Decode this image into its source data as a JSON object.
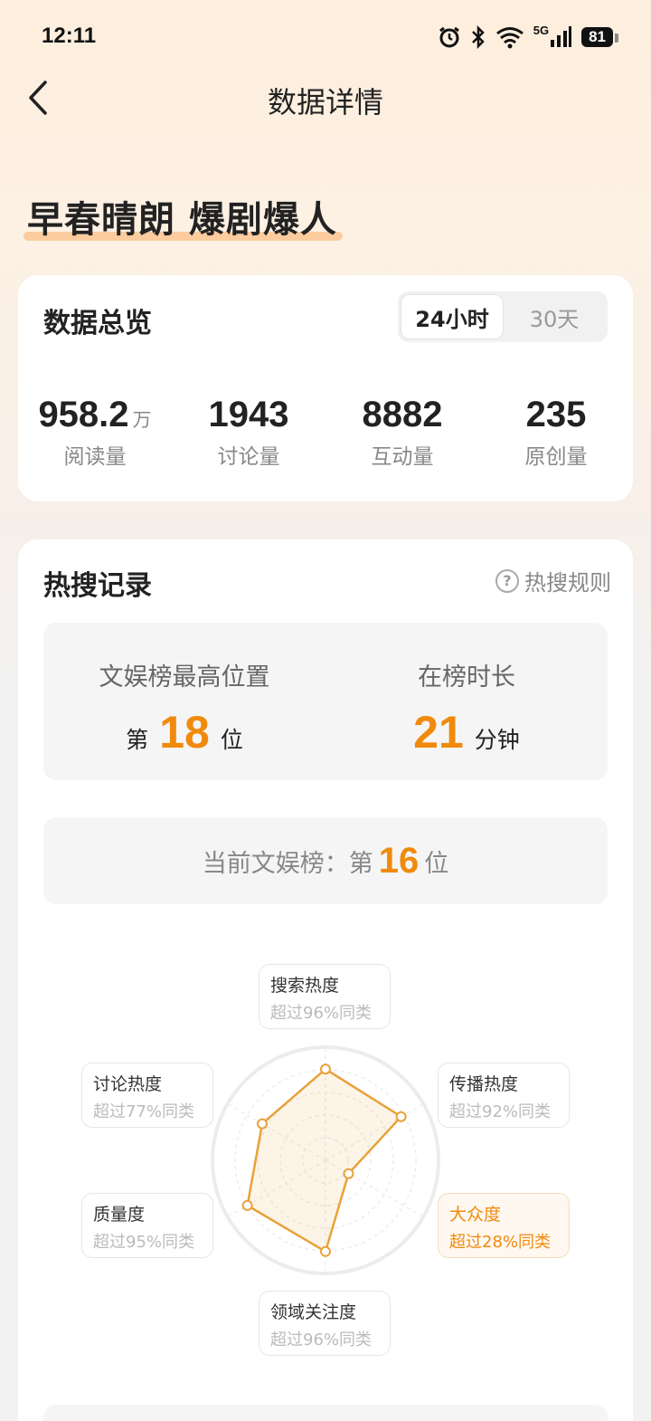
{
  "status": {
    "time": "12:11",
    "battery": "81",
    "network": "5G"
  },
  "nav": {
    "title": "数据详情"
  },
  "topic": {
    "title": "早春晴朗 爆剧爆人"
  },
  "overview": {
    "title": "数据总览",
    "tabs": [
      {
        "label": "24小时",
        "active": true
      },
      {
        "label": "30天",
        "active": false
      }
    ],
    "stats": [
      {
        "value": "958.2",
        "unit": "万",
        "label": "阅读量"
      },
      {
        "value": "1943",
        "unit": "",
        "label": "讨论量"
      },
      {
        "value": "8882",
        "unit": "",
        "label": "互动量"
      },
      {
        "value": "235",
        "unit": "",
        "label": "原创量"
      }
    ]
  },
  "hot_search": {
    "title": "热搜记录",
    "rules_label": "热搜规则",
    "best_rank": {
      "label": "文娱榜最高位置",
      "prefix": "第",
      "value": "18",
      "suffix": "位"
    },
    "duration": {
      "label": "在榜时长",
      "value": "21",
      "suffix": "分钟"
    },
    "current": {
      "label": "当前文娱榜：第",
      "value": "16",
      "suffix": "位"
    },
    "radar": {
      "accent": "#e8a23a",
      "dimensions": [
        {
          "name": "搜索热度",
          "desc": "超过96%同类",
          "score": 0.96,
          "highlight": false
        },
        {
          "name": "传播热度",
          "desc": "超过92%同类",
          "score": 0.92,
          "highlight": false
        },
        {
          "name": "大众度",
          "desc": "超过28%同类",
          "score": 0.28,
          "highlight": true
        },
        {
          "name": "领域关注度",
          "desc": "超过96%同类",
          "score": 0.96,
          "highlight": false
        },
        {
          "name": "质量度",
          "desc": "超过95%同类",
          "score": 0.95,
          "highlight": false
        },
        {
          "name": "讨论热度",
          "desc": "超过77%同类",
          "score": 0.77,
          "highlight": false
        }
      ]
    }
  },
  "colors": {
    "accent_orange": "#f08a0c",
    "underline": "#fbc592"
  }
}
